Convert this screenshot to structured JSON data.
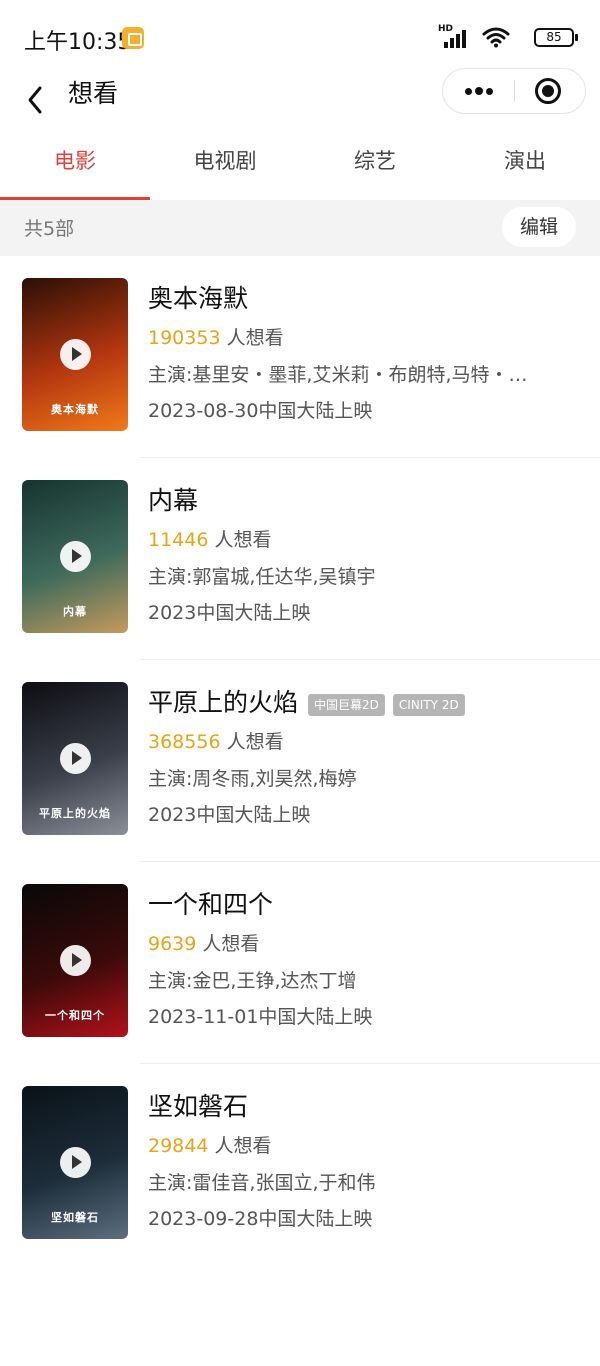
{
  "status_bar": {
    "time": "上午10:35",
    "battery": "85",
    "network_label": "HD"
  },
  "nav": {
    "title": "想看",
    "back_icon": "chevron-left-icon",
    "more_icon": "more-dots-icon",
    "close_icon": "target-icon"
  },
  "tabs": [
    {
      "label": "电影",
      "active": true
    },
    {
      "label": "电视剧",
      "active": false
    },
    {
      "label": "综艺",
      "active": false
    },
    {
      "label": "演出",
      "active": false
    }
  ],
  "summary": {
    "count_text": "共5部",
    "edit_label": "编辑"
  },
  "want_suffix": "人想看",
  "movies": [
    {
      "title": "奥本海默",
      "want_count": "190353",
      "cast": "主演:基里安・墨菲,艾米莉・布朗特,马特・…",
      "release": "2023-08-30中国大陆上映",
      "badges": [],
      "poster_text": "奥本海默",
      "poster_colors": [
        "#2a0f06",
        "#b3360f",
        "#f07a1b"
      ]
    },
    {
      "title": "内幕",
      "want_count": "11446",
      "cast": "主演:郭富城,任达华,吴镇宇",
      "release": "2023中国大陆上映",
      "badges": [],
      "poster_text": "内幕",
      "poster_colors": [
        "#16332f",
        "#3e6a5c",
        "#c59a5c"
      ]
    },
    {
      "title": "平原上的火焰",
      "want_count": "368556",
      "cast": "主演:周冬雨,刘昊然,梅婷",
      "release": "2023中国大陆上映",
      "badges": [
        "中国巨幕2D",
        "CINITY 2D"
      ],
      "poster_text": "平原上的火焰",
      "poster_colors": [
        "#0d0d12",
        "#3a3f4a",
        "#8a8f98"
      ]
    },
    {
      "title": "一个和四个",
      "want_count": "9639",
      "cast": "主演:金巴,王铮,达杰丁增",
      "release": "2023-11-01中国大陆上映",
      "badges": [],
      "poster_text": "一个和四个",
      "poster_colors": [
        "#080808",
        "#3b0a0a",
        "#b3121a"
      ]
    },
    {
      "title": "坚如磐石",
      "want_count": "29844",
      "cast": "主演:雷佳音,张国立,于和伟",
      "release": "2023-09-28中国大陆上映",
      "badges": [],
      "poster_text": "坚如磐石",
      "poster_colors": [
        "#0a1218",
        "#1d2d3a",
        "#5c6f80"
      ]
    }
  ],
  "colors": {
    "accent": "#e0413a",
    "want_count": "#e8a317",
    "badge_bg": "#b5b5b5"
  }
}
